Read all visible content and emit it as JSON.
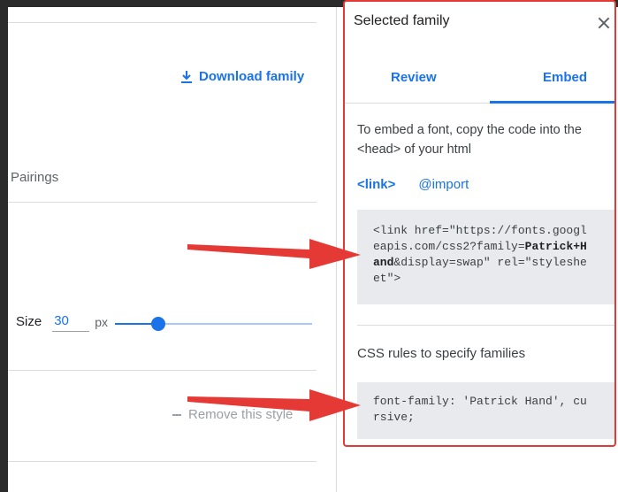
{
  "main": {
    "download_label": "Download family",
    "pairings_label": "Pairings",
    "size": {
      "label": "Size",
      "value": "30",
      "unit": "px",
      "slider_fraction": 0.22
    },
    "remove_label": "Remove this style"
  },
  "panel": {
    "title": "Selected family",
    "tabs": [
      {
        "label": "Review"
      },
      {
        "label": "Embed"
      }
    ],
    "active_tab": "Embed",
    "intro": "To embed a font, copy the code into the <head> of your html",
    "embed_options": [
      {
        "label": "<link>"
      },
      {
        "label": "@import"
      }
    ],
    "link_code": {
      "l1": "<link href=\"https://fonts.googl",
      "l2a": "eapis.com/css2?family=",
      "l2b": "Patrick+H",
      "l3a": "and",
      "l3b": "&display=swap\" rel=\"styleshe",
      "l4": "et\">"
    },
    "css_heading": "CSS rules to specify families",
    "css_code": {
      "l1": "font-family: 'Patrick Hand', cu",
      "l2": "rsive;"
    }
  },
  "colors": {
    "accent": "#1a73e8",
    "annotation_red": "#e53935",
    "code_bg": "#e8eaed"
  },
  "icons": {
    "download": "download-icon",
    "close": "close-icon",
    "remove": "minus-icon"
  }
}
